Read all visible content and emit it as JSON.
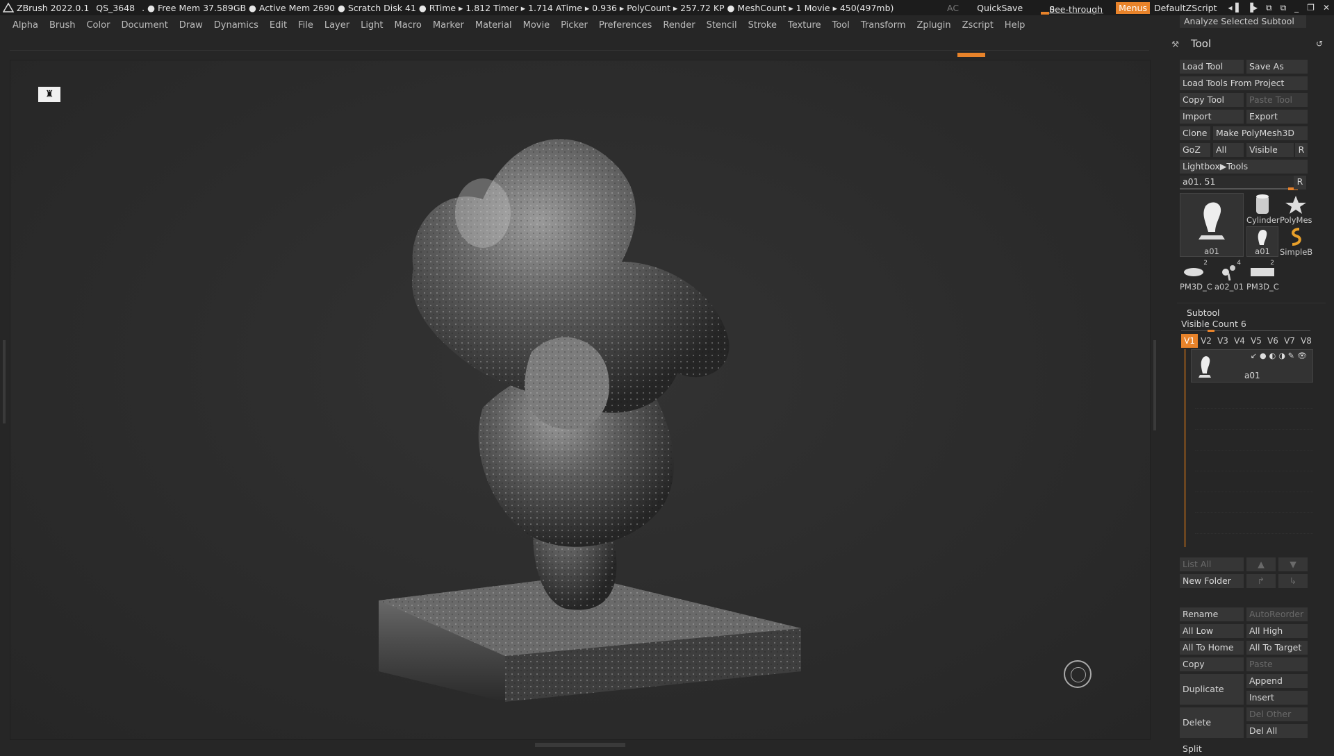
{
  "titlebar": {
    "app": "ZBrush 2022.0.1",
    "project": "QS_3648",
    "stats": ". ● Free Mem 37.589GB ● Active Mem 2690 ● Scratch Disk 41 ●  RTime ▸ 1.812 Timer ▸ 1.714 ATime ▸ 0.936 ▸ PolyCount ▸ 257.72 KP  ● MeshCount ▸ 1  Movie ▸ 450(497mb)",
    "ac": "AC",
    "quicksave": "QuickSave",
    "seethrough_label": "See-through",
    "seethrough_value": "0",
    "menus": "Menus",
    "script": "DefaultZScript"
  },
  "menubar": [
    "Alpha",
    "Brush",
    "Color",
    "Document",
    "Draw",
    "Dynamics",
    "Edit",
    "File",
    "Layer",
    "Light",
    "Macro",
    "Marker",
    "Material",
    "Movie",
    "Picker",
    "Preferences",
    "Render",
    "Stencil",
    "Stroke",
    "Texture",
    "Tool",
    "Transform",
    "Zplugin",
    "Zscript",
    "Help"
  ],
  "panel": {
    "analyze": "Analyze Selected Subtool",
    "title": "Tool",
    "load_tool": "Load Tool",
    "save_as": "Save As",
    "load_from_project": "Load Tools From Project",
    "copy_tool": "Copy Tool",
    "paste_tool": "Paste Tool",
    "import": "Import",
    "export": "Export",
    "clone": "Clone",
    "make_polymesh": "Make PolyMesh3D",
    "goz": "GoZ",
    "all": "All",
    "visible": "Visible",
    "r": "R",
    "lightbox": "Lightbox▶Tools",
    "slider_label": "a01. 51",
    "slider_fraction": 0.92,
    "thumbs": {
      "big": "a01",
      "cylinder": "Cylinder",
      "polymesh": "PolyMes",
      "a01_small": "a01",
      "simpleb": "SimpleB",
      "pm3d_1": "PM3D_C",
      "pm3d_1_count": "2",
      "a02": "a02_01",
      "a02_count": "4",
      "pm3d_2": "PM3D_C",
      "pm3d_2_count": "2"
    },
    "subtool": {
      "title": "Subtool",
      "visible_count": "Visible Count 6",
      "vtabs": [
        "V1",
        "V2",
        "V3",
        "V4",
        "V5",
        "V6",
        "V7",
        "V8"
      ],
      "item_name": "a01",
      "list_all": "List All",
      "new_folder": "New Folder",
      "rename": "Rename",
      "autoreorder": "AutoReorder",
      "all_low": "All Low",
      "all_high": "All High",
      "all_to_home": "All To Home",
      "all_to_target": "All To Target",
      "copy": "Copy",
      "paste": "Paste",
      "duplicate": "Duplicate",
      "append": "Append",
      "insert": "Insert",
      "del_other": "Del Other",
      "delete": "Delete",
      "del_all": "Del All",
      "split": "Split"
    }
  },
  "colors": {
    "accent": "#e8832a",
    "background": "#262626"
  }
}
